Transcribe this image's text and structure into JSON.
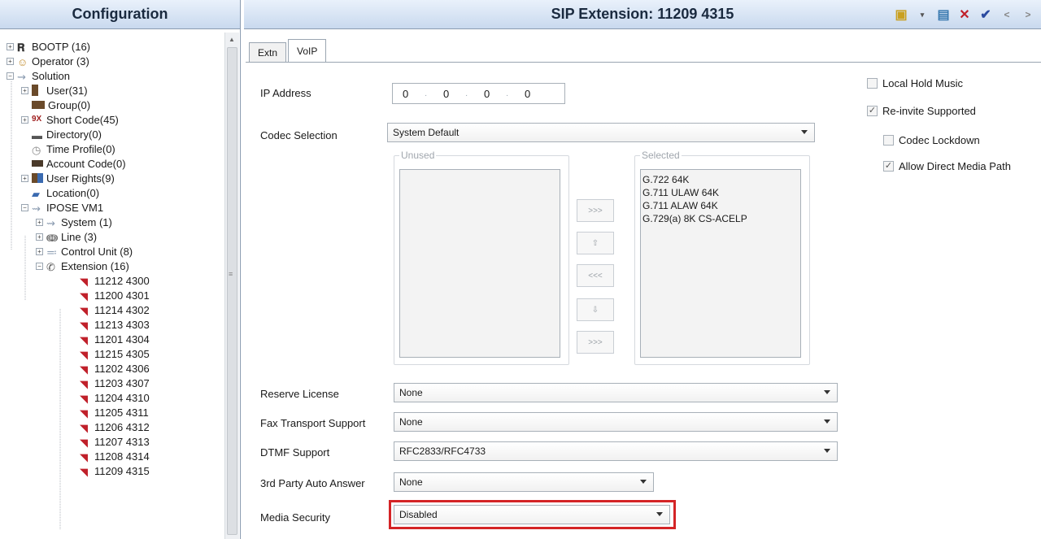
{
  "left_pane": {
    "title": "Configuration",
    "tree": [
      {
        "label": "BOOTP (16)",
        "icon": "bootp-icon"
      },
      {
        "label": "Operator (3)",
        "icon": "operator-icon"
      },
      {
        "label": "Solution",
        "icon": "solution-icon"
      },
      {
        "label": "User(31)",
        "icon": "user-icon"
      },
      {
        "label": "Group(0)",
        "icon": "group-icon"
      },
      {
        "label": "Short Code(45)",
        "icon": "shortcode-icon"
      },
      {
        "label": "Directory(0)",
        "icon": "directory-icon"
      },
      {
        "label": "Time Profile(0)",
        "icon": "clock-icon"
      },
      {
        "label": "Account Code(0)",
        "icon": "account-icon"
      },
      {
        "label": "User Rights(9)",
        "icon": "user-rights-icon"
      },
      {
        "label": "Location(0)",
        "icon": "location-icon"
      },
      {
        "label": "IPOSE VM1",
        "icon": "system-icon"
      },
      {
        "label": "System (1)",
        "icon": "system-icon"
      },
      {
        "label": "Line (3)",
        "icon": "line-icon"
      },
      {
        "label": "Control Unit (8)",
        "icon": "control-unit-icon"
      },
      {
        "label": "Extension (16)",
        "icon": "extension-icon"
      },
      {
        "label": "11212 4300",
        "icon": "extension-item-icon"
      },
      {
        "label": "11200 4301",
        "icon": "extension-item-icon"
      },
      {
        "label": "11214 4302",
        "icon": "extension-item-icon"
      },
      {
        "label": "11213 4303",
        "icon": "extension-item-icon"
      },
      {
        "label": "11201 4304",
        "icon": "extension-item-icon"
      },
      {
        "label": "11215 4305",
        "icon": "extension-item-icon"
      },
      {
        "label": "11202 4306",
        "icon": "extension-item-icon"
      },
      {
        "label": "11203 4307",
        "icon": "extension-item-icon"
      },
      {
        "label": "11204 4310",
        "icon": "extension-item-icon"
      },
      {
        "label": "11205 4311",
        "icon": "extension-item-icon"
      },
      {
        "label": "11206 4312",
        "icon": "extension-item-icon"
      },
      {
        "label": "11207 4313",
        "icon": "extension-item-icon"
      },
      {
        "label": "11208 4314",
        "icon": "extension-item-icon"
      },
      {
        "label": "11209 4315",
        "icon": "extension-item-icon"
      }
    ]
  },
  "right_pane": {
    "title": "SIP Extension: 11209 4315",
    "toolbar": {
      "new_icon": "new-icon",
      "save_icon": "save-icon",
      "delete_icon": "delete-icon",
      "ok_icon": "ok-icon",
      "prev_label": "<",
      "next_label": ">"
    },
    "tabs": [
      {
        "label": "Extn",
        "active": false
      },
      {
        "label": "VoIP",
        "active": true
      }
    ],
    "ip_address": {
      "label": "IP Address",
      "octets": [
        "0",
        "0",
        "0",
        "0"
      ]
    },
    "codec_selection": {
      "label": "Codec Selection",
      "value": "System Default"
    },
    "unused": {
      "title": "Unused",
      "items": []
    },
    "selected": {
      "title": "Selected",
      "items": [
        "G.722 64K",
        "G.711 ULAW 64K",
        "G.711 ALAW 64K",
        "G.729(a) 8K CS-ACELP"
      ]
    },
    "movers": [
      ">>>",
      "<<<",
      ">>>"
    ],
    "reserve_license": {
      "label": "Reserve License",
      "value": "None"
    },
    "fax_transport": {
      "label": "Fax Transport Support",
      "value": "None"
    },
    "dtmf_support": {
      "label": "DTMF Support",
      "value": "RFC2833/RFC4733"
    },
    "auto_answer": {
      "label": "3rd Party Auto Answer",
      "value": "None"
    },
    "media_security": {
      "label": "Media Security",
      "value": "Disabled"
    },
    "checkboxes": [
      {
        "label": "Local Hold Music",
        "checked": false
      },
      {
        "label": "Re-invite Supported",
        "checked": true
      },
      {
        "label": "Codec Lockdown",
        "checked": false
      },
      {
        "label": "Allow Direct Media Path",
        "checked": true
      }
    ],
    "highlight_color": "#d42426"
  }
}
